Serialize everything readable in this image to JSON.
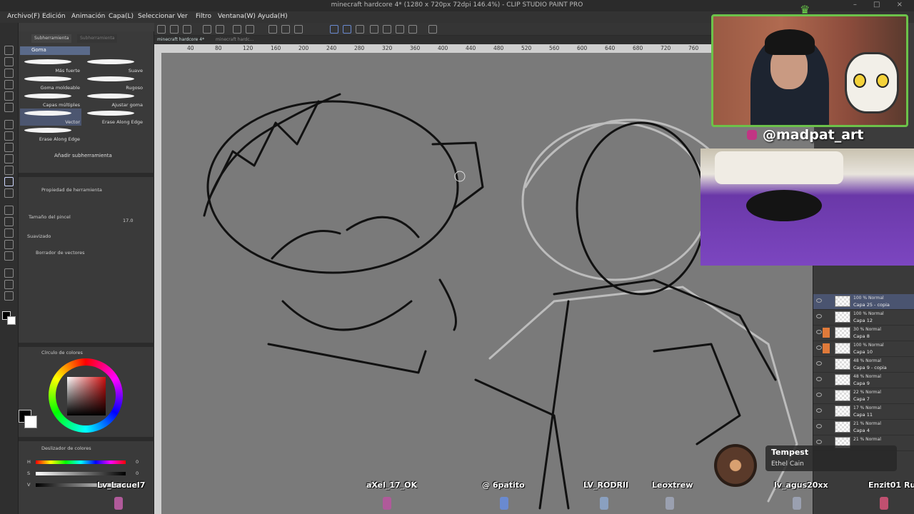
{
  "window": {
    "title": "minecraft hardcore 4* (1280 x 720px 72dpi 146.4%) - CLIP STUDIO PAINT PRO",
    "controls": "– □ ×"
  },
  "menu": [
    "Archivo(F)",
    "Edición",
    "Animación",
    "Capa(L)",
    "Seleccionar",
    "Ver",
    "Filtro",
    "Ventana(W)",
    "Ayuda(H)"
  ],
  "doc_tabs": [
    "minecraft hardcore 4*",
    "minecraft hardc..."
  ],
  "ruler_ticks": [
    "40",
    "80",
    "120",
    "160",
    "200",
    "240",
    "280",
    "320",
    "360",
    "400",
    "440",
    "480",
    "520",
    "560",
    "600",
    "640",
    "680",
    "720",
    "760"
  ],
  "subtool_panel": {
    "tabs": [
      "Subherramienta",
      "Subherramienta"
    ],
    "group": "Goma",
    "brushes": [
      "Más fuerte",
      "Suave",
      "Goma moldeable",
      "Rugoso",
      "Capas múltiples",
      "Ajustar goma",
      "Vector",
      "Erase Along Edge",
      "Erase Along Edge"
    ],
    "add_label": "Añadir subherramienta"
  },
  "tool_property": {
    "title": "Propiedad de herramienta",
    "brush_size_label": "Tamaño del pincel",
    "brush_size_value": "17.0",
    "smoothing_label": "Suavizado",
    "vector_eraser_label": "Borrador de vectores"
  },
  "color_panel": {
    "title": "Círculo de colores",
    "slider_title": "Deslizador de colores",
    "h_label": "H",
    "s_label": "S",
    "v_label": "V",
    "h_value": "0",
    "s_value": "0",
    "v_value": "0",
    "fg_color": "#000000",
    "bg_color": "#ffffff"
  },
  "layers": [
    {
      "mode": "100 % Normal",
      "name": "Capa 25 - copia"
    },
    {
      "mode": "100 % Normal",
      "name": "Capa 12"
    },
    {
      "mode": "30 % Normal",
      "name": "Capa 8"
    },
    {
      "mode": "100 % Normal",
      "name": "Capa 10"
    },
    {
      "mode": "48 % Normal",
      "name": "Capa 9 - copia"
    },
    {
      "mode": "48 % Normal",
      "name": "Capa 9"
    },
    {
      "mode": "22 % Normal",
      "name": "Capa 7"
    },
    {
      "mode": "17 % Normal",
      "name": "Capa 11"
    },
    {
      "mode": "21 % Normal",
      "name": "Capa 4"
    },
    {
      "mode": "21 % Normal",
      "name": ""
    }
  ],
  "stream": {
    "handle": "@madpat_art",
    "now_playing": {
      "title": "Tempest",
      "artist": "Ethel Cain"
    },
    "viewers": [
      "Lv_Lacuel7",
      "aXel_17_OK",
      "@ 6patito",
      "LV_RODRII",
      "Leoxtrew",
      "lv_agus20xx",
      "Enzit01",
      "Ru"
    ]
  },
  "colors": {
    "accent": "#6cc24a",
    "selection": "#4a5470",
    "layer_marker": "#e07a3a",
    "canvas_bg": "#7a7a7a"
  }
}
